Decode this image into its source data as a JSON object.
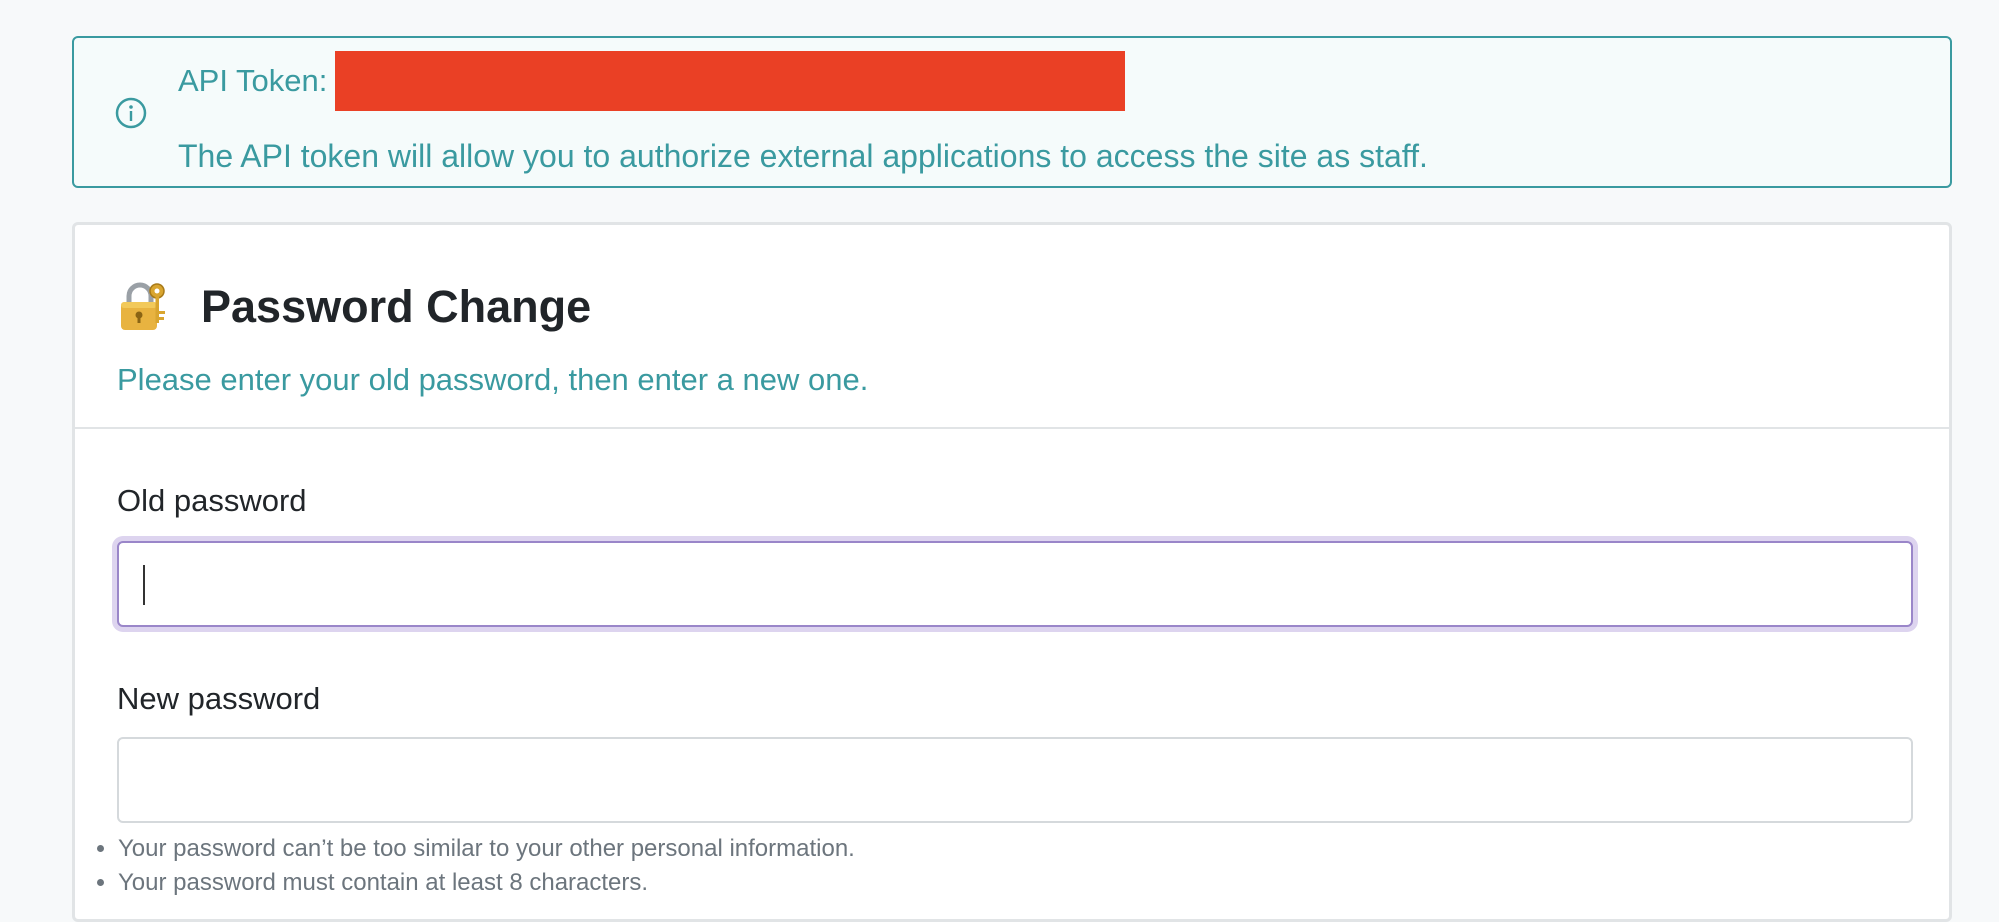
{
  "alert": {
    "token_label": "API Token:",
    "description": "The API token will allow you to authorize external applications to access the site as staff.",
    "icon": "info-circle-icon",
    "color": "#3a9aa0"
  },
  "card": {
    "icon": "lock-with-key-icon",
    "title": "Password Change",
    "subtitle": "Please enter your old password, then enter a new one.",
    "fields": {
      "old_password": {
        "label": "Old password",
        "value": "",
        "focused": true
      },
      "new_password": {
        "label": "New password",
        "value": ""
      }
    },
    "help": [
      "Your password can’t be too similar to your other personal information.",
      "Your password must contain at least 8 characters."
    ]
  },
  "colors": {
    "accent": "#3a9aa0",
    "redaction": "#ea4025",
    "focus_border": "#9a86c9"
  }
}
